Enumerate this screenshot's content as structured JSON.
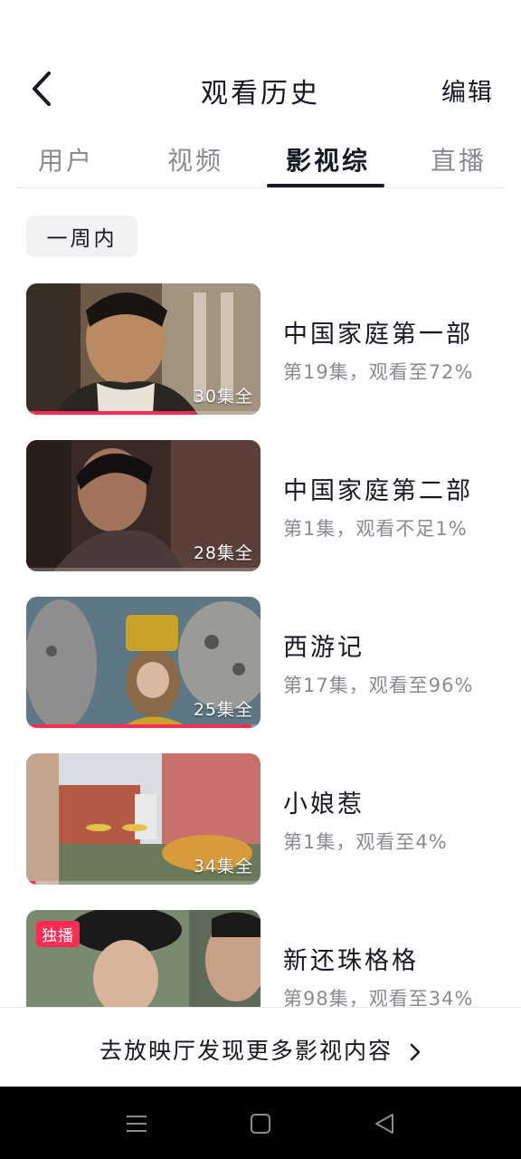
{
  "header": {
    "back_icon": "chevron-left-icon",
    "title": "观看历史",
    "edit_label": "编辑"
  },
  "tabs": [
    {
      "label": "用户",
      "active": false
    },
    {
      "label": "视频",
      "active": false
    },
    {
      "label": "影视综",
      "active": true
    },
    {
      "label": "直播",
      "active": false
    }
  ],
  "section": {
    "label": "一周内"
  },
  "items": [
    {
      "title": "中国家庭第一部",
      "subtitle": "第19集，观看至72%",
      "episodes": "30集全",
      "progress": 0.72,
      "badge": ""
    },
    {
      "title": "中国家庭第二部",
      "subtitle": "第1集，观看不足1%",
      "episodes": "28集全",
      "progress": 0.01,
      "badge": ""
    },
    {
      "title": "西游记",
      "subtitle": "第17集，观看至96%",
      "episodes": "25集全",
      "progress": 0.96,
      "badge": ""
    },
    {
      "title": "小娘惹",
      "subtitle": "第1集，观看至4%",
      "episodes": "34集全",
      "progress": 0.04,
      "badge": ""
    },
    {
      "title": "新还珠格格",
      "subtitle": "第98集，观看至34%",
      "episodes": "",
      "progress": 0.34,
      "badge": "独播"
    }
  ],
  "footer": {
    "label": "去放映厅发现更多影视内容",
    "chevron_icon": "chevron-right-icon"
  },
  "system_nav": {
    "menu_icon": "menu-icon",
    "home_icon": "home-icon",
    "back_icon": "back-triangle-icon"
  },
  "colors": {
    "accent": "#fe2c55",
    "text_primary": "#161823",
    "text_secondary": "#8a8b91"
  }
}
